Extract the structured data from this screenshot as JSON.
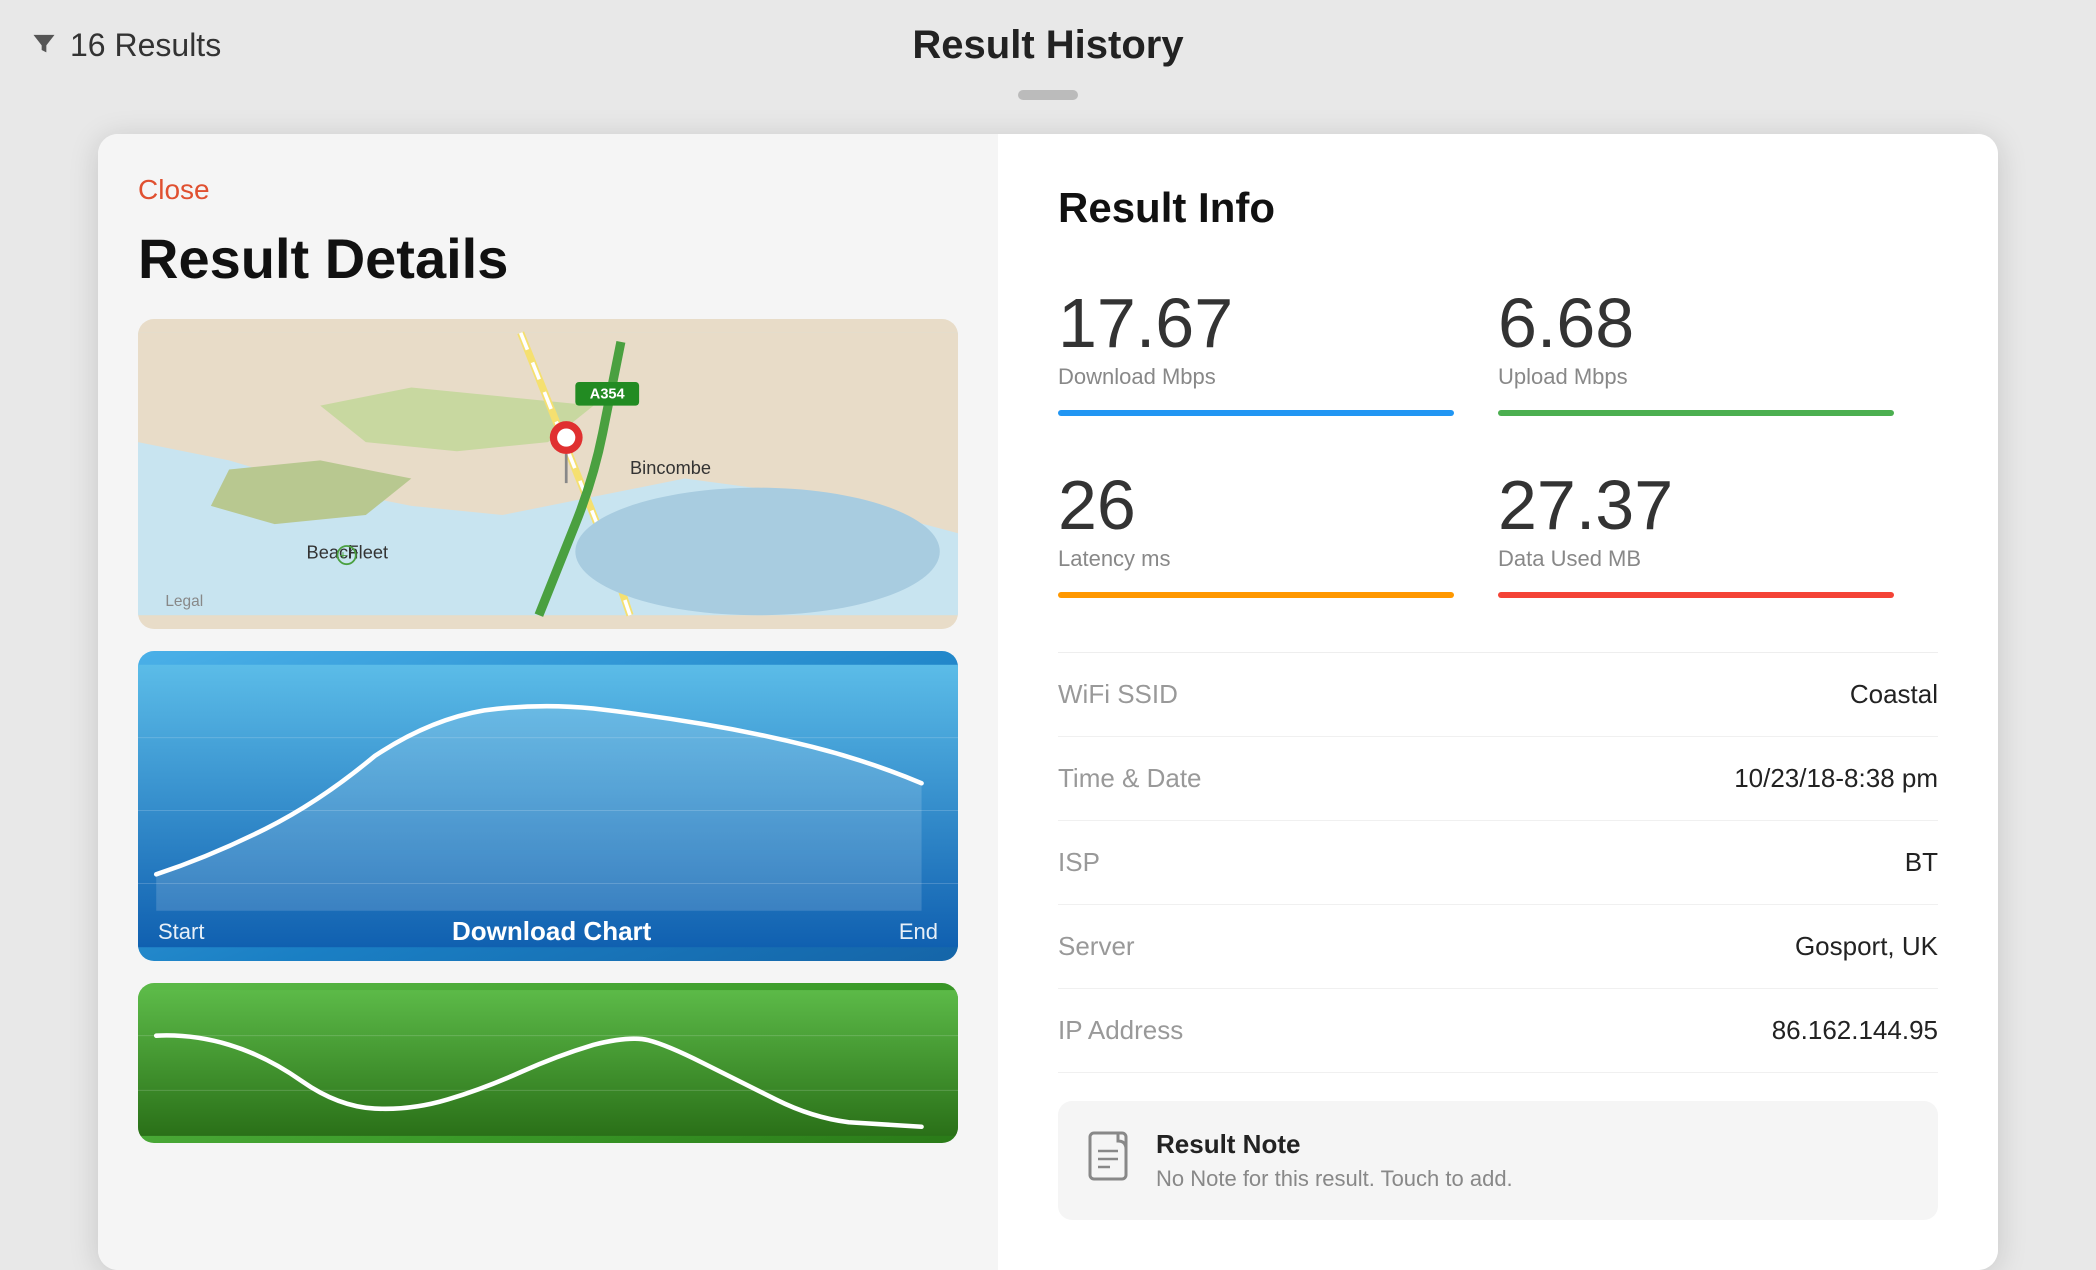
{
  "topbar": {
    "results_count": "16 Results",
    "title": "Result History"
  },
  "left": {
    "close_label": "Close",
    "details_title": "Result Details",
    "chart_start": "Start",
    "chart_title": "Download Chart",
    "chart_end": "End"
  },
  "right": {
    "info_title": "Result Info",
    "download_value": "17.67",
    "download_label": "Download Mbps",
    "upload_value": "6.68",
    "upload_label": "Upload Mbps",
    "latency_value": "26",
    "latency_label": "Latency ms",
    "data_value": "27.37",
    "data_label": "Data Used MB",
    "rows": [
      {
        "label": "WiFi SSID",
        "value": "Coastal"
      },
      {
        "label": "Time & Date",
        "value": "10/23/18-8:38 pm"
      },
      {
        "label": "ISP",
        "value": "BT"
      },
      {
        "label": "Server",
        "value": "Gosport, UK"
      },
      {
        "label": "IP Address",
        "value": "86.162.144.95"
      }
    ],
    "note_title": "Result Note",
    "note_subtitle": "No Note for this result. Touch to add."
  }
}
